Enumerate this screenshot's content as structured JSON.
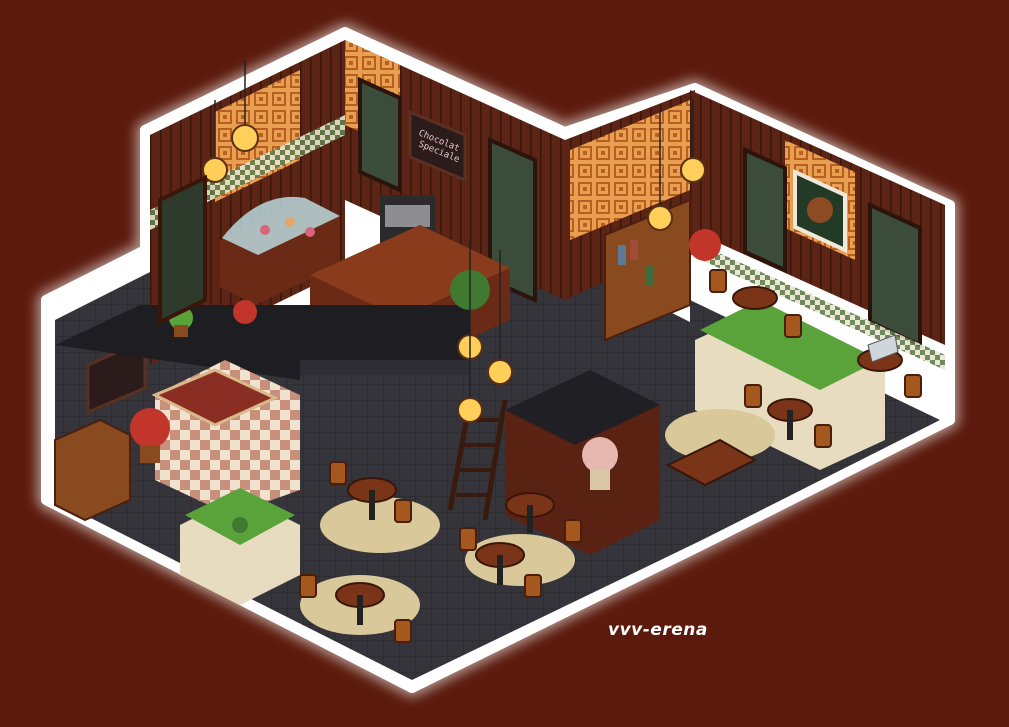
{
  "scene": {
    "credit": "vvv-erena",
    "chalkboard": {
      "line1": "Chocolat",
      "line2": "Speciale"
    }
  },
  "colors": {
    "background": "#5b1a0c",
    "outline": "#ffffff",
    "floor": "#2f2f33",
    "wood_dark": "#4a1e12",
    "wood_mid": "#7a3418",
    "wallpaper": "#e8a050",
    "lamp_glow": "#ffcf5a",
    "rug": "#d9c89a",
    "plant": "#5aa33a"
  },
  "icons": [
    "pendant-lamp-icon",
    "cafe-table-icon",
    "potted-plant-icon",
    "bookshelf-icon",
    "window-icon",
    "coffee-machine-icon",
    "pastry-display-case-icon",
    "staircase-icon",
    "laptop-icon",
    "portrait-frame-icon",
    "chalkboard-icon"
  ]
}
